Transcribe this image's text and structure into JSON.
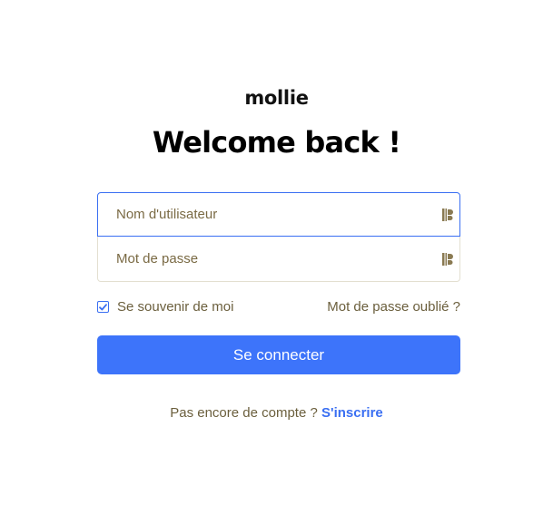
{
  "brand": {
    "logo_text": "mollie"
  },
  "heading": {
    "title": "Welcome back !"
  },
  "form": {
    "username": {
      "placeholder": "Nom d'utilisateur",
      "value": ""
    },
    "password": {
      "placeholder": "Mot de passe",
      "value": ""
    },
    "remember_label": "Se souvenir de moi",
    "remember_checked": true,
    "forgot_label": "Mot de passe oublié ?",
    "submit_label": "Se connecter"
  },
  "signup": {
    "prompt": "Pas encore de compte ?",
    "link_label": "S'inscrire"
  },
  "colors": {
    "accent": "#3d74fa",
    "text_muted": "#6b5f3d",
    "field_border": "#e3dfd0"
  },
  "icons": {
    "field_autofill": "key-autofill-icon",
    "checkbox": "checkmark-icon"
  }
}
